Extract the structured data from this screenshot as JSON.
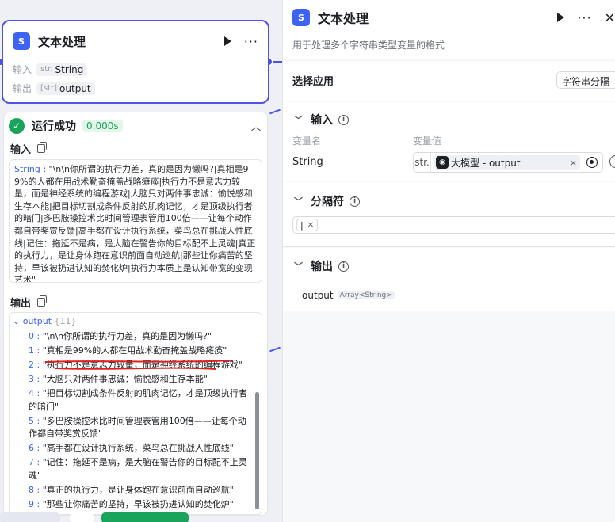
{
  "node": {
    "title": "文本处理",
    "icon": "text-processing-icon",
    "input_label": "输入",
    "input_type_prefix": "str.",
    "input_type": "String",
    "output_label": "输出",
    "output_type_prefix": "[str]",
    "output_name": "output"
  },
  "run": {
    "status": "运行成功",
    "duration": "0.000s",
    "input_title": "输入",
    "input_key": "String",
    "input_value": "\"\\n\\n你所谓的执行力差，真的是因为懒吗?|真相是99%的人都在用战术勤奋掩盖战略瘫痪|执行力不是意志力较量，而是神经系统的编程游戏|大脑只对两件事忠诚：愉悦感和生存本能|把目标切割成条件反射的肌肉记忆，才是顶级执行者的暗门|多巴胺操控术比时间管理表管用100倍——让每个动作都自带奖赏反馈|高手都在设计执行系统，菜鸟总在挑战人性底线|记住：拖延不是病，是大脑在警告你的目标配不上灵魂|真正的执行力，是让身体跑在意识前面自动巡航|那些让你痛苦的坚持，早该被扔进认知的焚化炉|执行力本质上是认知带宽的变现艺术\"",
    "output_title": "输出",
    "output_root": "output",
    "output_count": "{11}",
    "output_items": [
      {
        "idx": "0",
        "text": "\"\\n\\n你所谓的执行力差，真的是因为懒吗?\""
      },
      {
        "idx": "1",
        "text": "\"真相是99%的人都在用战术勤奋掩盖战略瘫痪\""
      },
      {
        "idx": "2",
        "text": "\"执行力不是意志力较量，而是神经系统的编程游戏\""
      },
      {
        "idx": "3",
        "text": "\"大脑只对两件事忠诚：愉悦感和生存本能\""
      },
      {
        "idx": "4",
        "text": "\"把目标切割成条件反射的肌肉记忆，才是顶级执行者的暗门\""
      },
      {
        "idx": "5",
        "text": "\"多巴胺操控术比时间管理表管用100倍——让每个动作都自带奖赏反馈\""
      },
      {
        "idx": "6",
        "text": "\"高手都在设计执行系统，菜鸟总在挑战人性底线\""
      },
      {
        "idx": "7",
        "text": "\"记住：拖延不是病，是大脑在警告你的目标配不上灵魂\""
      },
      {
        "idx": "8",
        "text": "\"真正的执行力，是让身体跑在意识前面自动巡航\""
      },
      {
        "idx": "9",
        "text": "\"那些让你痛苦的坚持，早该被扔进认知的焚化炉\""
      }
    ]
  },
  "panel": {
    "title": "文本处理",
    "description": "用于处理多个字符串类型变量的格式",
    "select_app_label": "选择应用",
    "select_app_value": "字符串分隔",
    "input_section": "输入",
    "col_var_name": "变量名",
    "col_var_value": "变量值",
    "var_name": "String",
    "var_type": "str.",
    "var_ref": "大模型 - output",
    "separator_section": "分隔符",
    "separator_chip": "|",
    "output_section": "输出",
    "output_var": "output",
    "output_var_type": "Array<String>"
  },
  "colors": {
    "accent": "#4d53e8",
    "success": "#1aa45b",
    "link": "#3d63f5",
    "annotation": "#e02020"
  }
}
